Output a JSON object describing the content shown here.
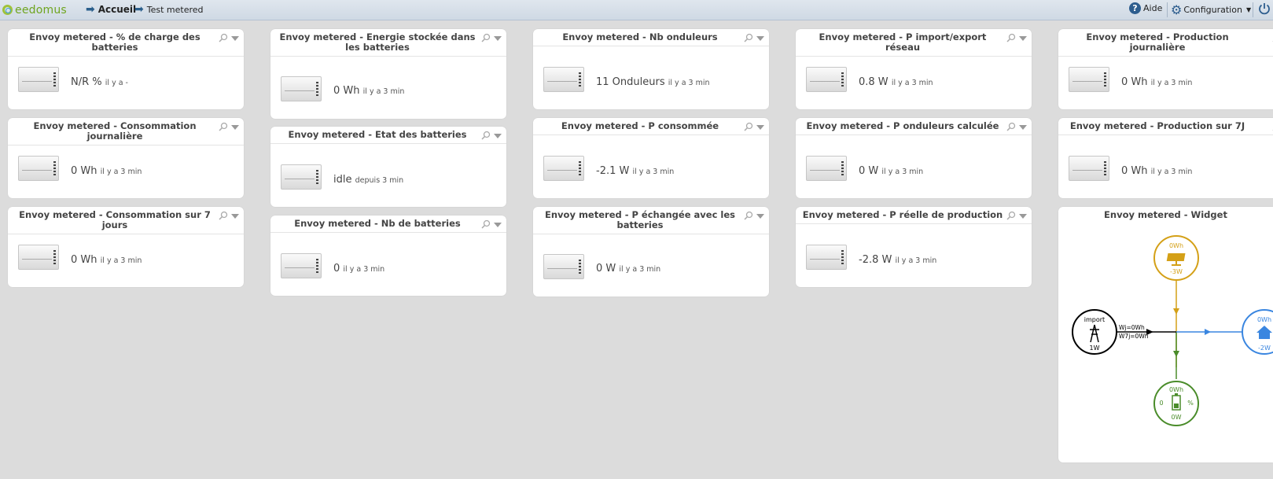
{
  "header": {
    "logo_text": "eedomus",
    "breadcrumb_home": "Accueil",
    "breadcrumb_page": "Test metered",
    "help_label": "Aide",
    "config_label": "Configuration"
  },
  "widgets": [
    {
      "title": "Envoy metered - % de charge des batteries",
      "value": "N/R %",
      "since": "il y a -"
    },
    {
      "title": "Envoy metered - Consommation journalière",
      "value": "0 Wh",
      "since": "il y a 3 min"
    },
    {
      "title": "Envoy metered - Consommation sur 7 jours",
      "value": "0 Wh",
      "since": "il y a 3 min"
    },
    {
      "title": "Envoy metered - Energie stockée dans les batteries",
      "value": "0 Wh",
      "since": "il y a 3 min"
    },
    {
      "title": "Envoy metered - Etat des batteries",
      "value": "idle",
      "since": "depuis 3 min"
    },
    {
      "title": "Envoy metered - Nb de batteries",
      "value": "0",
      "since": "il y a 3 min"
    },
    {
      "title": "Envoy metered - Nb onduleurs",
      "value": "11 Onduleurs",
      "since": "il y a 3 min"
    },
    {
      "title": "Envoy metered - P consommée",
      "value": "-2.1 W",
      "since": "il y a 3 min"
    },
    {
      "title": "Envoy metered - P échangée avec les batteries",
      "value": "0 W",
      "since": "il y a 3 min"
    },
    {
      "title": "Envoy metered - P import/export réseau",
      "value": "0.8 W",
      "since": "il y a 3 min"
    },
    {
      "title": "Envoy metered - P onduleurs calculée",
      "value": "0 W",
      "since": "il y a 3 min"
    },
    {
      "title": "Envoy metered - P réelle de production",
      "value": "-2.8 W",
      "since": "il y a 3 min"
    },
    {
      "title": "Envoy metered - Production journalière",
      "value": "0 Wh",
      "since": "il y a 3 min"
    },
    {
      "title": "Envoy metered - Production sur 7J",
      "value": "0 Wh",
      "since": "il y a 3 min"
    }
  ],
  "flow_widget": {
    "title": "Envoy metered - Widget",
    "solar_top": "0Wh",
    "solar_bottom": "-3W",
    "grid_label": "import",
    "grid_value": "1W",
    "grid_day": "Wj=0Wh",
    "grid_week": "W7j=0Wh",
    "home_top": "0Wh",
    "home_bottom": "-2W",
    "battery_top": "0Wh",
    "battery_left": "0",
    "battery_right": "%",
    "battery_bottom": "0W",
    "colors": {
      "solar": "#d4a017",
      "battery": "#4a8c2a",
      "home": "#3a86e0",
      "grid": "#000000"
    }
  }
}
